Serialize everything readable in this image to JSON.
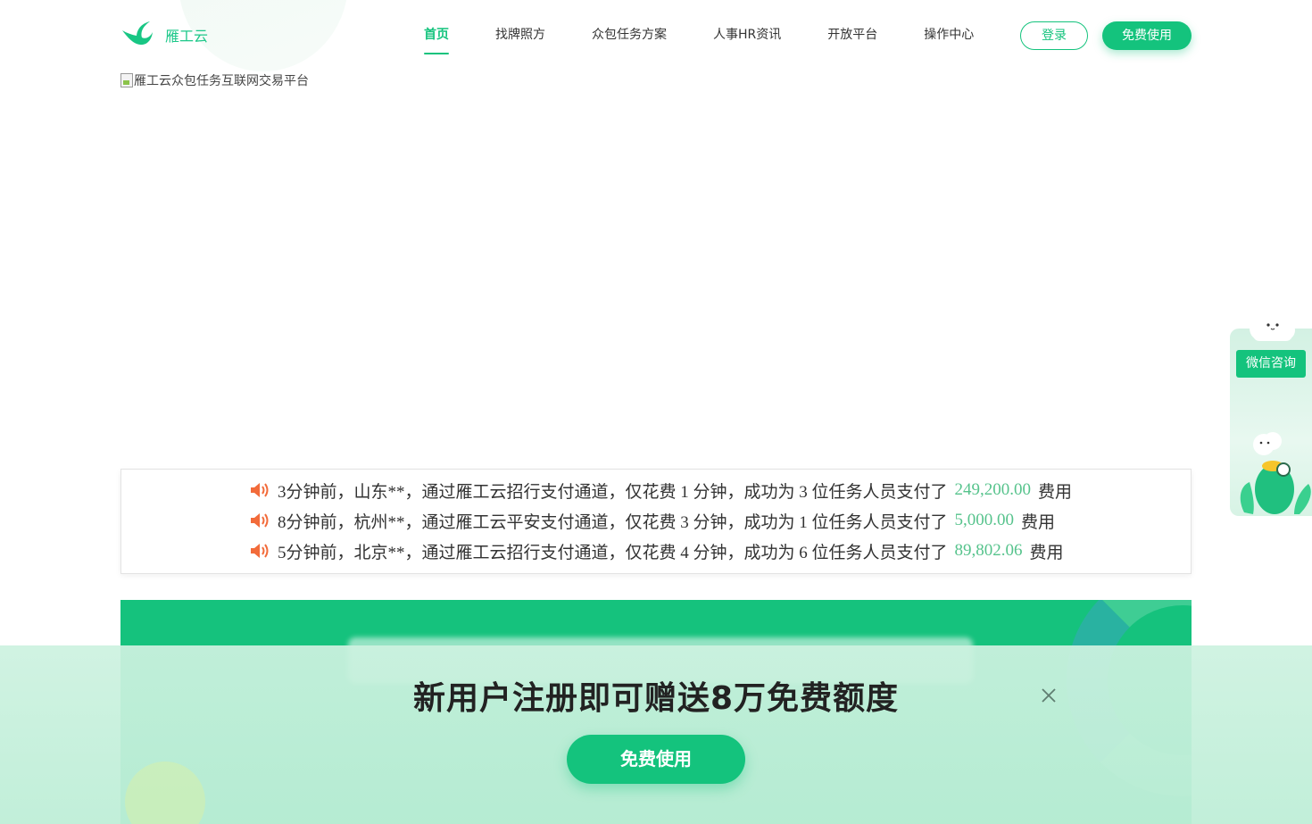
{
  "header": {
    "logo_text": "雁工云",
    "nav": [
      {
        "label": "首页",
        "active": true
      },
      {
        "label": "找牌照方"
      },
      {
        "label": "众包任务方案"
      },
      {
        "label": "人事HR资讯"
      },
      {
        "label": "开放平台"
      },
      {
        "label": "操作中心"
      }
    ],
    "login_label": "登录",
    "free_label": "免费使用"
  },
  "banner": {
    "alt": "雁工云众包任务互联网交易平台"
  },
  "ticker": [
    {
      "text": "3分钟前，山东**，通过雁工云招行支付通道，仅花费 1 分钟，成功为 3 位任务人员支付了",
      "amount": "249,200.00",
      "suffix": "费用"
    },
    {
      "text": "8分钟前，杭州**，通过雁工云平安支付通道，仅花费 3 分钟，成功为 1 位任务人员支付了",
      "amount": "5,000.00",
      "suffix": "费用"
    },
    {
      "text": "5分钟前，北京**，通过雁工云招行支付通道，仅花费 4 分钟，成功为 6 位任务人员支付了",
      "amount": "89,802.06",
      "suffix": "费用"
    }
  ],
  "promo": {
    "title": "新用户注册即可赠送8万免费额度",
    "button": "免费使用"
  },
  "side": {
    "wechat": "微信咨询"
  },
  "colors": {
    "brand": "#14c37d",
    "amount": "#56c38c",
    "speaker": "#f26b3a"
  }
}
